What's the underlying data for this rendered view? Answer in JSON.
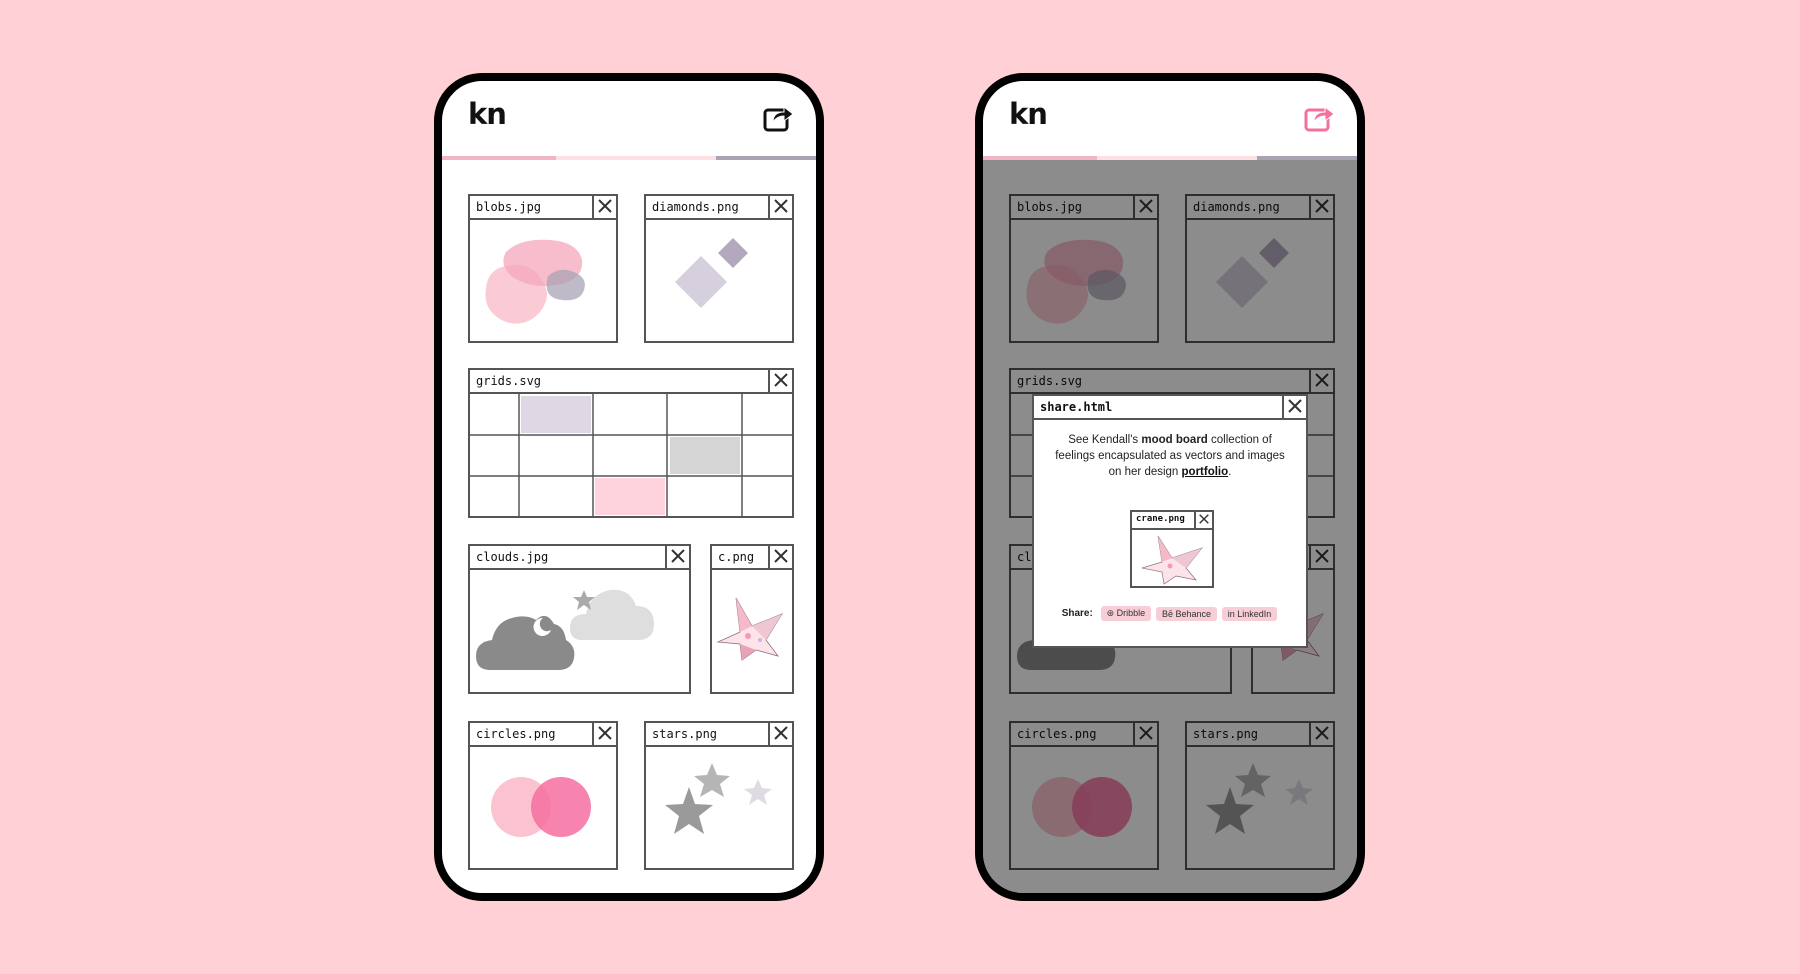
{
  "app": {
    "logo": "kn"
  },
  "windows": {
    "blobs": "blobs.jpg",
    "diamonds": "diamonds.png",
    "grids": "grids.svg",
    "clouds": "clouds.jpg",
    "crane": "c.png",
    "circles": "circles.png",
    "stars": "stars.png"
  },
  "share_modal": {
    "title": "share.html",
    "text_before": "See Kendall's ",
    "text_bold": "mood board",
    "text_middle": " collection of feelings encapsulated as vectors and images on her design ",
    "link_label": "portfolio",
    "text_after": ".",
    "preview_title": "crane.png",
    "share_label": "Share:",
    "links": {
      "dribbble": "⊛ Dribble",
      "behance": "Bē Behance",
      "linkedin": "in LinkedIn"
    }
  },
  "colors": {
    "background": "#ffd1d6",
    "accent_pink": "#f56fa0",
    "pink_light": "#f9b9c7",
    "lavender": "#b3a9bd",
    "grey": "#888888"
  },
  "icons": {
    "share": "share-arrow-icon",
    "close": "close-x-icon"
  }
}
